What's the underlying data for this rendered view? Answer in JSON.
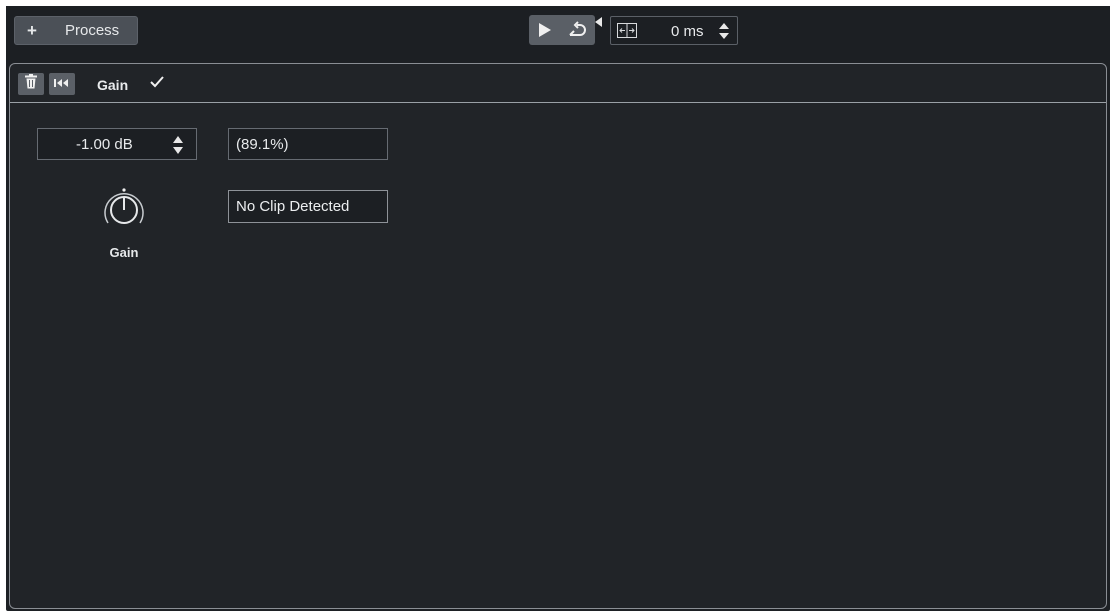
{
  "toolbar": {
    "process_label": "Process",
    "plus_glyph": "+",
    "play_icon": "play-icon",
    "loop_icon": "loop-icon",
    "crossfade_icon": "crossfade-icon",
    "prelisten_value": "0 ms"
  },
  "panel": {
    "title": "Gain",
    "delete_icon": "trash-icon",
    "reset_icon": "skip-back-icon",
    "active_icon": "checkmark-icon",
    "gain_value": "-1.00 dB",
    "gain_percent": "(89.1%)",
    "clip_status": "No Clip Detected",
    "knob_label": "Gain",
    "knob_level": 0.5
  },
  "colors": {
    "background": "#1d2024",
    "panel": "#212428",
    "button": "#4b5057",
    "text": "#e8eaec"
  }
}
